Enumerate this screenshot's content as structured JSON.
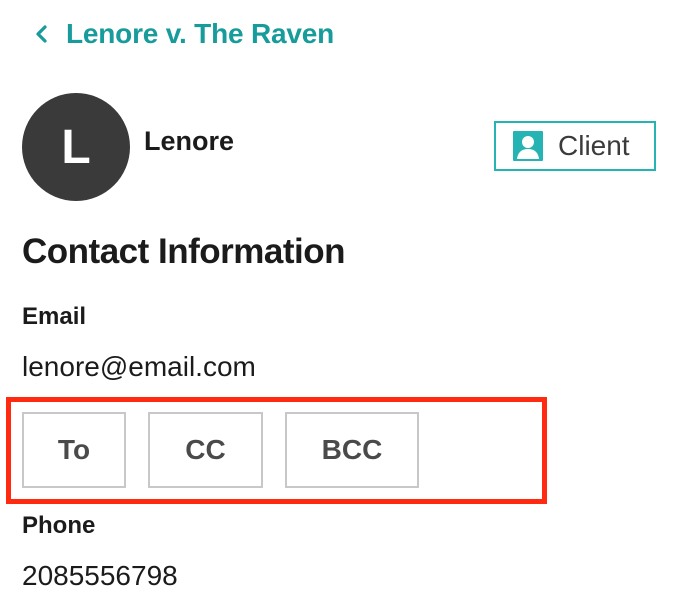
{
  "header": {
    "back_title": "Lenore v. The Raven"
  },
  "contact": {
    "avatar_initial": "L",
    "name": "Lenore",
    "role_badge": "Client"
  },
  "contact_information": {
    "heading": "Contact Information",
    "email": {
      "label": "Email",
      "value": "lenore@email.com",
      "buttons": {
        "to": "To",
        "cc": "CC",
        "bcc": "BCC"
      }
    },
    "phone": {
      "label": "Phone",
      "value": "2085556798"
    }
  },
  "colors": {
    "accent_teal": "#179b9b",
    "badge_border": "#25b3b3",
    "avatar_bg": "#3a3a3a",
    "highlight": "#ff2a0f"
  },
  "icons": {
    "back": "chevron-left-icon",
    "client": "person-badge-icon"
  }
}
